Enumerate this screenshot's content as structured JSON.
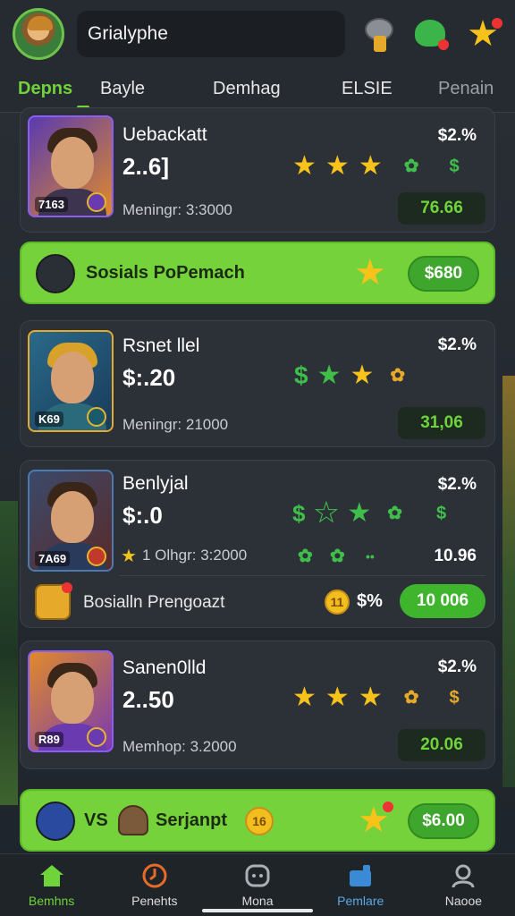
{
  "header": {
    "search_text": "Grialyphe"
  },
  "tabs": [
    {
      "label": "Depns",
      "active": true
    },
    {
      "label": "Bayle"
    },
    {
      "label": "Demhag"
    },
    {
      "label": "ELSIE"
    },
    {
      "label": "Penain"
    }
  ],
  "cards": [
    {
      "name": "Uebackatt",
      "price": "2..6]",
      "pct": "$2.%",
      "meta": "Meningr: 3:3000",
      "value": "76.66",
      "portrait_badge": "7163"
    },
    {
      "name": "Rsnet llel",
      "price": "$:.20",
      "pct": "$2.%",
      "meta": "Meningr: 21000",
      "value": "31,06",
      "portrait_badge": "K69"
    },
    {
      "name": "Benlyjal",
      "price": "$:.0",
      "pct": "$2.%",
      "meta": "1 Olhgr: 3:2000",
      "value": "10.96",
      "portrait_badge": "7A69"
    },
    {
      "name": "Sanen0lld",
      "price": "2..50",
      "pct": "$2.%",
      "meta": "Memhop: 3.2000",
      "value": "20.06",
      "portrait_badge": "R89"
    }
  ],
  "promos": {
    "first": {
      "label": "Sosials PoPemach",
      "button": "$680"
    },
    "inline": {
      "label": "Bosialln Prengoazt",
      "pct": "$%",
      "coin": "11",
      "button": "10 006"
    },
    "last": {
      "vs": "VS",
      "label": "Serjanpt",
      "coin": "16",
      "button": "$6.00"
    }
  },
  "bottom_nav": [
    {
      "label": "Bemhns",
      "active": true
    },
    {
      "label": "Penehts"
    },
    {
      "label": "Mona"
    },
    {
      "label": "Pemlare"
    },
    {
      "label": "Naooe"
    }
  ],
  "colors": {
    "accent_green": "#6fd33a",
    "promo_green": "#76d23a",
    "star_gold": "#f7c21a",
    "card_bg": "#2c3137"
  }
}
